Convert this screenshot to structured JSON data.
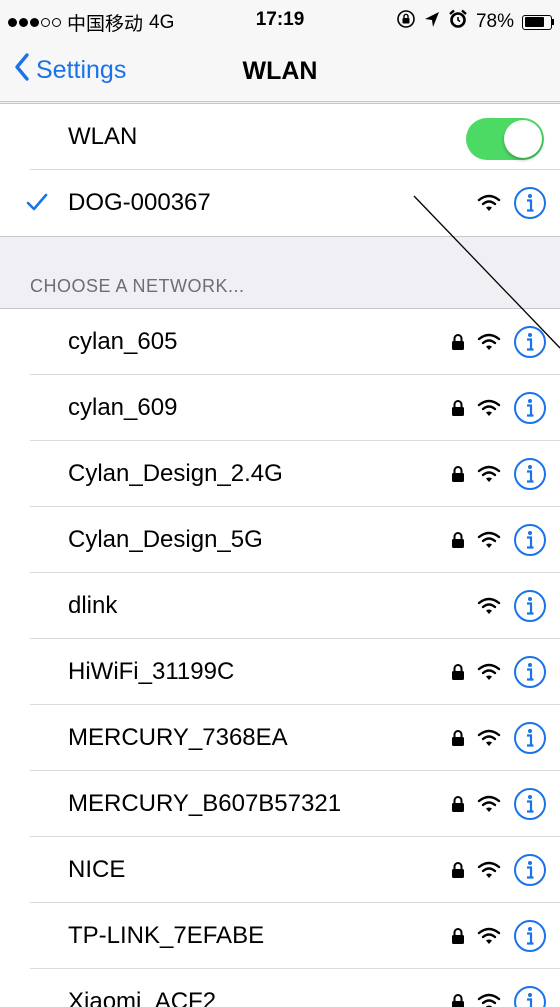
{
  "status_bar": {
    "carrier": "中国移动",
    "network": "4G",
    "time": "17:19",
    "battery": "78%",
    "battery_level": 0.78,
    "signal_bars": 3,
    "signal_total": 5
  },
  "nav": {
    "back_label": "Settings",
    "title": "WLAN"
  },
  "wlan_toggle": {
    "label": "WLAN",
    "on": true
  },
  "connected": {
    "name": "DOG-000367",
    "locked": false
  },
  "section_header": "CHOOSE A NETWORK...",
  "networks": [
    {
      "name": "cylan_605",
      "locked": true
    },
    {
      "name": "cylan_609",
      "locked": true
    },
    {
      "name": "Cylan_Design_2.4G",
      "locked": true
    },
    {
      "name": "Cylan_Design_5G",
      "locked": true
    },
    {
      "name": "dlink",
      "locked": false
    },
    {
      "name": "HiWiFi_31199C",
      "locked": true
    },
    {
      "name": "MERCURY_7368EA",
      "locked": true
    },
    {
      "name": "MERCURY_B607B57321",
      "locked": true
    },
    {
      "name": "NICE",
      "locked": true
    },
    {
      "name": "TP-LINK_7EFABE",
      "locked": true
    },
    {
      "name": "Xiaomi_ACF2",
      "locked": true
    }
  ],
  "colors": {
    "accent": "#1a73e8",
    "toggle_on": "#4cd964",
    "background": "#efeff4"
  }
}
